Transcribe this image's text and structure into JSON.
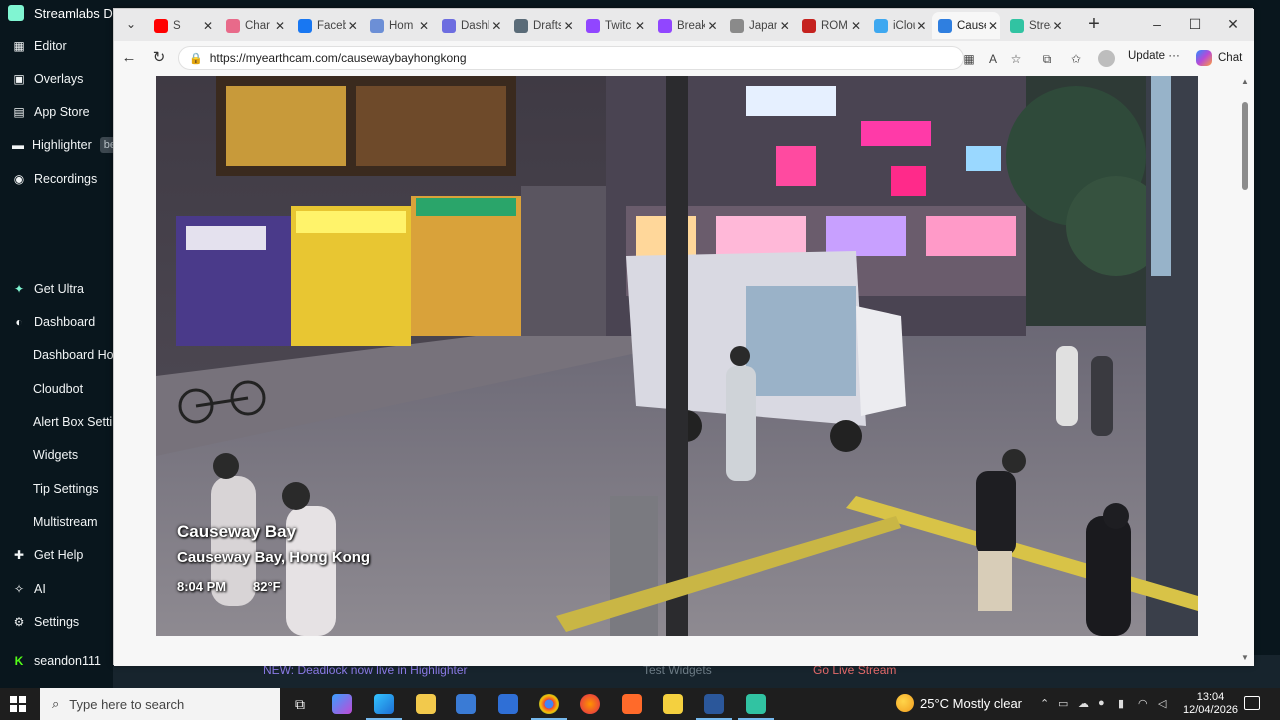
{
  "streamlabs": {
    "title": "Streamlabs De",
    "nav": [
      {
        "label": "Editor",
        "icon": "editor-icon"
      },
      {
        "label": "Overlays",
        "icon": "overlays-icon"
      },
      {
        "label": "App Store",
        "icon": "app-store-icon"
      },
      {
        "label": "Highlighter",
        "icon": "highlighter-icon",
        "badge": "be"
      },
      {
        "label": "Recordings",
        "icon": "recordings-icon"
      },
      {
        "label": "Get Ultra",
        "icon": "ultra-icon"
      },
      {
        "label": "Dashboard",
        "icon": "dashboard-icon"
      },
      {
        "label": "Dashboard Hor"
      },
      {
        "label": "Cloudbot"
      },
      {
        "label": "Alert Box Settin"
      },
      {
        "label": "Widgets"
      },
      {
        "label": "Tip Settings"
      },
      {
        "label": "Multistream"
      },
      {
        "label": "Get Help",
        "icon": "help-icon"
      },
      {
        "label": "AI",
        "icon": "ai-icon"
      },
      {
        "label": "Settings",
        "icon": "settings-icon"
      },
      {
        "label": "seandon111",
        "icon": "kick-icon"
      }
    ],
    "bottom": {
      "banner": "NEW: Deadlock now live in Highlighter",
      "test_widgets": "Test Widgets",
      "go_live": "Go Live Stream"
    }
  },
  "browser": {
    "tabs": [
      {
        "label": "S",
        "icon": "youtube-icon",
        "color": "#ff0000"
      },
      {
        "label": "Char",
        "icon": "tab-site-icon",
        "color": "#e86a8a"
      },
      {
        "label": "Faceb",
        "icon": "facebook-icon",
        "color": "#1877f2"
      },
      {
        "label": "Hom",
        "icon": "tab-site-icon",
        "color": "#6c8fd6"
      },
      {
        "label": "Dashl",
        "icon": "tab-site-icon",
        "color": "#6d6de0"
      },
      {
        "label": "Drafts",
        "icon": "drafts-icon",
        "color": "#5a6b78"
      },
      {
        "label": "Twitc",
        "icon": "twitch-icon",
        "color": "#9146ff"
      },
      {
        "label": "Break",
        "icon": "twitch-icon",
        "color": "#9146ff"
      },
      {
        "label": "Japan",
        "icon": "search-icon",
        "color": "#8a8a8a"
      },
      {
        "label": "ROM",
        "icon": "gmail-icon",
        "color": "#c5221f"
      },
      {
        "label": "iClou",
        "icon": "icloud-icon",
        "color": "#3ea8f0"
      },
      {
        "label": "Cause",
        "icon": "edge-icon",
        "color": "#2f7fe0",
        "active": true
      },
      {
        "label": "Strea",
        "icon": "streamlabs-icon",
        "color": "#31c3a2"
      }
    ],
    "url": "https://myearthcam.com/causewaybayhongkong",
    "update_label": "Update",
    "chat_label": "Chat"
  },
  "video": {
    "title": "Causeway Bay",
    "location": "Causeway Bay, Hong Kong",
    "time": "8:04 PM",
    "temp": "82°F"
  },
  "taskbar": {
    "search_placeholder": "Type here to search",
    "weather": "25°C  Mostly clear",
    "time": "13:04",
    "date": "12/04/2026"
  }
}
